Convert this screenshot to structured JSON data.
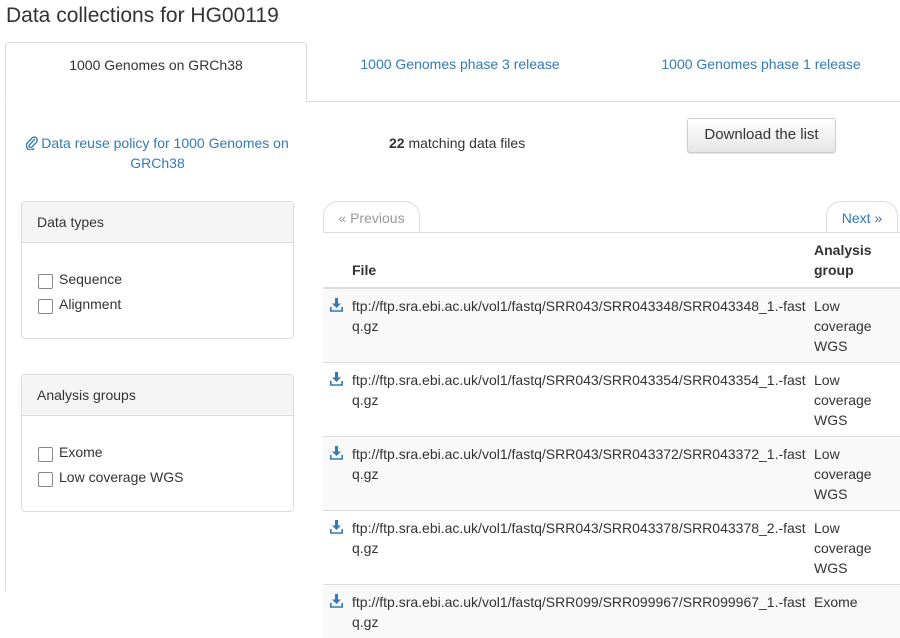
{
  "page": {
    "title": "Data collections for HG00119"
  },
  "tabs": [
    {
      "label": "1000 Genomes on GRCh38",
      "active": true
    },
    {
      "label": "1000 Genomes phase 3 release",
      "active": false
    },
    {
      "label": "1000 Genomes phase 1 release",
      "active": false
    }
  ],
  "reuse_link": {
    "label": "Data reuse policy for 1000 Genomes on GRCh38",
    "icon": "paperclip-icon"
  },
  "matching": {
    "count": "22",
    "suffix": " matching data files"
  },
  "download_button": {
    "label": "Download the list"
  },
  "filters": {
    "data_types": {
      "heading": "Data types",
      "options": [
        "Sequence",
        "Alignment"
      ]
    },
    "analysis_groups": {
      "heading": "Analysis groups",
      "options": [
        "Exome",
        "Low coverage WGS"
      ]
    }
  },
  "pager": {
    "previous": "« Previous",
    "next": "Next »"
  },
  "table": {
    "headers": {
      "file": "File",
      "group": "Analysis group"
    },
    "rows": [
      {
        "file": "ftp://ftp.sra.ebi.ac.uk/vol1/fastq/SRR043/SRR043348/SRR043348_1.-fastq.gz",
        "group": "Low coverage WGS"
      },
      {
        "file": "ftp://ftp.sra.ebi.ac.uk/vol1/fastq/SRR043/SRR043354/SRR043354_1.-fastq.gz",
        "group": "Low coverage WGS"
      },
      {
        "file": "ftp://ftp.sra.ebi.ac.uk/vol1/fastq/SRR043/SRR043372/SRR043372_1.-fastq.gz",
        "group": "Low coverage WGS"
      },
      {
        "file": "ftp://ftp.sra.ebi.ac.uk/vol1/fastq/SRR043/SRR043378/SRR043378_2.-fastq.gz",
        "group": "Low coverage WGS"
      },
      {
        "file": "ftp://ftp.sra.ebi.ac.uk/vol1/fastq/SRR099/SRR099967/SRR099967_1.-fastq.gz",
        "group": "Exome"
      }
    ]
  },
  "colors": {
    "link": "#337ab7",
    "border": "#dddddd",
    "panel_heading": "#f5f5f5",
    "stripe": "#f9f9f9"
  }
}
